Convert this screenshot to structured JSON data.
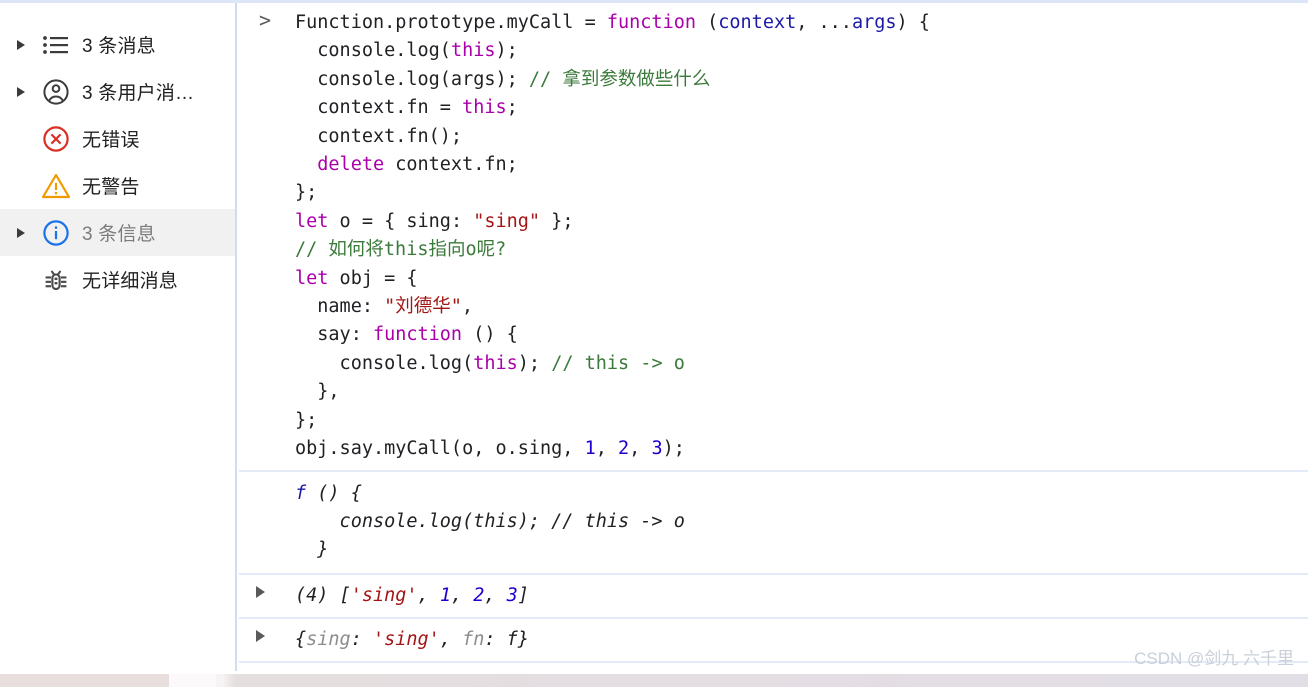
{
  "window": {
    "app": "Chrome DevTools Console",
    "watermark": "CSDN @剑九 六千里"
  },
  "sidebar": {
    "items": [
      {
        "label": "3 条消息",
        "icon": "list-icon",
        "expandable": true,
        "selected": false
      },
      {
        "label": "3 条用户消…",
        "icon": "user-icon",
        "expandable": true,
        "selected": false
      },
      {
        "label": "无错误",
        "icon": "error-icon",
        "expandable": false,
        "selected": false
      },
      {
        "label": "无警告",
        "icon": "warning-icon",
        "expandable": false,
        "selected": false
      },
      {
        "label": "3 条信息",
        "icon": "info-icon",
        "expandable": true,
        "selected": true
      },
      {
        "label": "无详细消息",
        "icon": "bug-icon",
        "expandable": false,
        "selected": false
      }
    ]
  },
  "console": {
    "prompt_glyph": ">",
    "input_lines": [
      {
        "segs": [
          {
            "t": "Function.prototype.myCall = ",
            "c": "plain"
          },
          {
            "t": "function",
            "c": "kw"
          },
          {
            "t": " (",
            "c": "plain"
          },
          {
            "t": "context",
            "c": "par"
          },
          {
            "t": ", ...",
            "c": "plain"
          },
          {
            "t": "args",
            "c": "par"
          },
          {
            "t": ") {",
            "c": "plain"
          }
        ]
      },
      {
        "segs": [
          {
            "t": "  console.log(",
            "c": "plain"
          },
          {
            "t": "this",
            "c": "kw"
          },
          {
            "t": ");",
            "c": "plain"
          }
        ]
      },
      {
        "segs": [
          {
            "t": "  console.log(args); ",
            "c": "plain"
          },
          {
            "t": "// 拿到参数做些什么",
            "c": "cmt"
          }
        ]
      },
      {
        "segs": [
          {
            "t": "  context.fn = ",
            "c": "plain"
          },
          {
            "t": "this",
            "c": "kw"
          },
          {
            "t": ";",
            "c": "plain"
          }
        ]
      },
      {
        "segs": [
          {
            "t": "  context.fn();",
            "c": "plain"
          }
        ]
      },
      {
        "segs": [
          {
            "t": "  ",
            "c": "plain"
          },
          {
            "t": "delete",
            "c": "kw"
          },
          {
            "t": " context.fn;",
            "c": "plain"
          }
        ]
      },
      {
        "segs": [
          {
            "t": "};",
            "c": "plain"
          }
        ]
      },
      {
        "segs": [
          {
            "t": "let",
            "c": "kw"
          },
          {
            "t": " o = { sing: ",
            "c": "plain"
          },
          {
            "t": "\"sing\"",
            "c": "str"
          },
          {
            "t": " };",
            "c": "plain"
          }
        ]
      },
      {
        "segs": [
          {
            "t": "// 如何将this指向o呢?",
            "c": "cmt"
          }
        ]
      },
      {
        "segs": [
          {
            "t": "let",
            "c": "kw"
          },
          {
            "t": " obj = {",
            "c": "plain"
          }
        ]
      },
      {
        "segs": [
          {
            "t": "  name: ",
            "c": "plain"
          },
          {
            "t": "\"刘德华\"",
            "c": "str"
          },
          {
            "t": ",",
            "c": "plain"
          }
        ]
      },
      {
        "segs": [
          {
            "t": "  say: ",
            "c": "plain"
          },
          {
            "t": "function",
            "c": "kw"
          },
          {
            "t": " () {",
            "c": "plain"
          }
        ]
      },
      {
        "segs": [
          {
            "t": "    console.log(",
            "c": "plain"
          },
          {
            "t": "this",
            "c": "kw"
          },
          {
            "t": "); ",
            "c": "plain"
          },
          {
            "t": "// this -> o",
            "c": "cmt"
          }
        ]
      },
      {
        "segs": [
          {
            "t": "  },",
            "c": "plain"
          }
        ]
      },
      {
        "segs": [
          {
            "t": "};",
            "c": "plain"
          }
        ]
      },
      {
        "segs": [
          {
            "t": "obj.say.myCall(o, o.sing, ",
            "c": "plain"
          },
          {
            "t": "1",
            "c": "num"
          },
          {
            "t": ", ",
            "c": "plain"
          },
          {
            "t": "2",
            "c": "num"
          },
          {
            "t": ", ",
            "c": "plain"
          },
          {
            "t": "3",
            "c": "num"
          },
          {
            "t": ");",
            "c": "plain"
          }
        ]
      }
    ],
    "outputs": [
      {
        "expandable": false,
        "lines": [
          {
            "segs": [
              {
                "t": "f",
                "c": "fnblue"
              },
              {
                "t": " () {",
                "c": "plain"
              }
            ]
          },
          {
            "segs": [
              {
                "t": "    console.log(this); // this -> o",
                "c": "plain"
              }
            ]
          },
          {
            "segs": [
              {
                "t": "  }",
                "c": "plain"
              }
            ]
          }
        ]
      },
      {
        "expandable": true,
        "lines": [
          {
            "segs": [
              {
                "t": "(4) [",
                "c": "plain"
              },
              {
                "t": "'sing'",
                "c": "str"
              },
              {
                "t": ", ",
                "c": "plain"
              },
              {
                "t": "1",
                "c": "num"
              },
              {
                "t": ", ",
                "c": "plain"
              },
              {
                "t": "2",
                "c": "num"
              },
              {
                "t": ", ",
                "c": "plain"
              },
              {
                "t": "3",
                "c": "num"
              },
              {
                "t": "]",
                "c": "plain"
              }
            ]
          }
        ]
      },
      {
        "expandable": true,
        "lines": [
          {
            "segs": [
              {
                "t": "{",
                "c": "plain"
              },
              {
                "t": "sing",
                "c": "grey"
              },
              {
                "t": ": ",
                "c": "plain"
              },
              {
                "t": "'sing'",
                "c": "str"
              },
              {
                "t": ", ",
                "c": "plain"
              },
              {
                "t": "fn",
                "c": "grey"
              },
              {
                "t": ": ",
                "c": "plain"
              },
              {
                "t": "f",
                "c": "plain"
              },
              {
                "t": "}",
                "c": "plain"
              }
            ]
          }
        ]
      }
    ]
  },
  "colors": {
    "keyword": "#aa00aa",
    "param": "#1a1aa6",
    "comment": "#3a7a3a",
    "string": "#a31515",
    "number": "#1c00cf",
    "error": "#d93025",
    "warning": "#f29900",
    "info": "#1a73e8",
    "divider": "#e3ebf9"
  }
}
